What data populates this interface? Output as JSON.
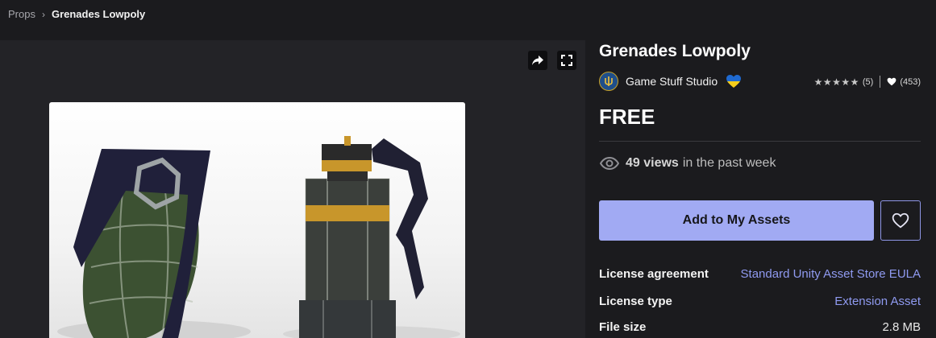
{
  "breadcrumb": {
    "parent": "Props",
    "current": "Grenades Lowpoly"
  },
  "viewer": {
    "share_icon": "share-arrow-icon",
    "fullscreen_icon": "fullscreen-icon"
  },
  "asset": {
    "title": "Grenades Lowpoly",
    "publisher": "Game Stuff Studio",
    "rating_stars": "★★★★★",
    "rating_count": "(5)",
    "favorites_count": "(453)",
    "price": "FREE",
    "views_count": "49 views",
    "views_suffix": "in the past week"
  },
  "actions": {
    "add_label": "Add to My Assets",
    "accent_color": "#a1aaf3"
  },
  "details": [
    {
      "key": "License agreement",
      "value": "Standard Unity Asset Store EULA"
    },
    {
      "key": "License type",
      "value": "Extension Asset"
    },
    {
      "key": "File size",
      "value": "2.8 MB"
    }
  ]
}
